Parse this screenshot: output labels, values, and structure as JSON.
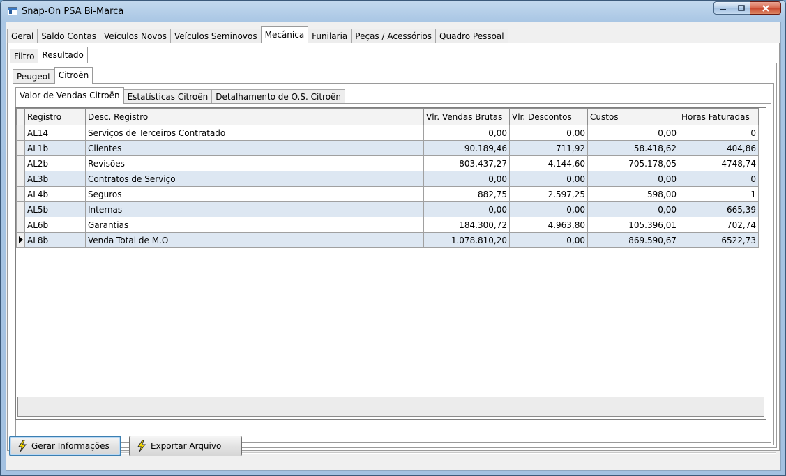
{
  "window": {
    "title": "Snap-On PSA Bi-Marca",
    "icon": "app-window-icon"
  },
  "main_tabs": [
    {
      "label": "Geral"
    },
    {
      "label": "Saldo Contas"
    },
    {
      "label": "Veículos Novos"
    },
    {
      "label": "Veículos Seminovos"
    },
    {
      "label": "Mecânica"
    },
    {
      "label": "Funilaria"
    },
    {
      "label": "Peças / Acessórios"
    },
    {
      "label": "Quadro Pessoal"
    }
  ],
  "mode_tabs": [
    {
      "label": "Filtro"
    },
    {
      "label": "Resultado"
    }
  ],
  "brand_tabs": [
    {
      "label": "Peugeot"
    },
    {
      "label": "Citroën"
    }
  ],
  "report_tabs": [
    {
      "label": "Valor de Vendas Citroën"
    },
    {
      "label": "Estatísticas Citroën"
    },
    {
      "label": "Detalhamento de O.S. Citroën"
    }
  ],
  "grid": {
    "columns": [
      "Registro",
      "Desc. Registro",
      "Vlr. Vendas Brutas",
      "Vlr. Descontos",
      "Custos",
      "Horas Faturadas"
    ],
    "rows": [
      [
        "AL14",
        "Serviços de Terceiros Contratado",
        "0,00",
        "0,00",
        "0,00",
        "0"
      ],
      [
        "AL1b",
        "Clientes",
        "90.189,46",
        "711,92",
        "58.418,62",
        "404,86"
      ],
      [
        "AL2b",
        "Revisões",
        "803.437,27",
        "4.144,60",
        "705.178,05",
        "4748,74"
      ],
      [
        "AL3b",
        "Contratos de Serviço",
        "0,00",
        "0,00",
        "0,00",
        "0"
      ],
      [
        "AL4b",
        "Seguros",
        "882,75",
        "2.597,25",
        "598,00",
        "1"
      ],
      [
        "AL5b",
        "Internas",
        "0,00",
        "0,00",
        "0,00",
        "665,39"
      ],
      [
        "AL6b",
        "Garantias",
        "184.300,72",
        "4.963,80",
        "105.396,01",
        "702,74"
      ],
      [
        "AL8b",
        "Venda Total de M.O",
        "1.078.810,20",
        "0,00",
        "869.590,67",
        "6522,73"
      ]
    ]
  },
  "buttons": {
    "gerar": "Gerar Informações",
    "exportar": "Exportar Arquivo"
  },
  "colors": {
    "alt_row": "#dde7f2",
    "focus_border": "#3c7fb1",
    "icon_yellow": "#f5d800"
  }
}
